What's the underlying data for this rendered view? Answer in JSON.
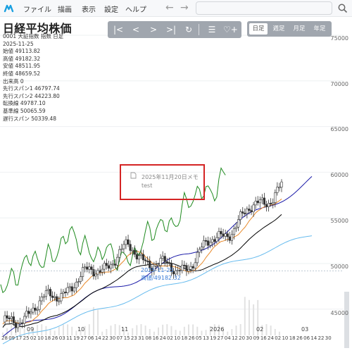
{
  "menubar": {
    "items": [
      "ファイル",
      "描画",
      "表示",
      "設定",
      "ヘルプ"
    ],
    "back_icon": "arrow-left-icon",
    "forward_icon": "arrow-right-icon",
    "search_icon": "search-icon"
  },
  "stock": {
    "title": "日経平均株価",
    "code_line": "0001 大証指数 指数  日足",
    "date": "2025-11-25",
    "open": "始値 49113.82",
    "high": "高値 49182.32",
    "low": "安値 48511.95",
    "close": "終値 48659.52",
    "volume": "出来高 0",
    "span1": "先行スパン1 46797.74",
    "span2": "先行スパン2 44223.80",
    "tenkan": "転換線 49787.10",
    "kijun": "基準線 50065.59",
    "chikou": "遅行スパン 50339.48"
  },
  "toolbar": {
    "buttons": [
      "|<",
      "<",
      ">",
      ">|",
      "↻",
      "☰",
      "♡+"
    ]
  },
  "period": {
    "options": [
      "日足",
      "週足",
      "月足",
      "年足"
    ],
    "active": "日足"
  },
  "memo": {
    "line1": "2025年11月20日メモ",
    "line2": "test"
  },
  "crosshair": {
    "date": "2025-11-25",
    "value": "高値/49182.32"
  },
  "y_axis": [
    "75000",
    "70000",
    "65000",
    "60000",
    "55000",
    "50000",
    "45000"
  ],
  "x_axis": {
    "days": [
      "28",
      "09",
      "17",
      "25",
      "02",
      "10",
      "18",
      "26",
      "03",
      "11",
      "19",
      "27",
      "06",
      "14",
      "22",
      "30",
      "07",
      "15",
      "23",
      "31",
      "08",
      "16",
      "24",
      "02",
      "10",
      "18",
      "26",
      "05",
      "13",
      "19",
      "27",
      "04",
      "12",
      "20",
      "30",
      "09",
      "16",
      "24",
      "02",
      "10",
      "18",
      "26",
      "06",
      "14",
      "22",
      "30"
    ],
    "months": [
      "09",
      "10",
      "11",
      "02",
      "03"
    ],
    "year": "2026"
  },
  "colors": {
    "candle": "#333333",
    "tenkan": "#e88a2b",
    "kijun": "#000000",
    "chikou": "#1e8a1e",
    "span1": "#1a1aa8",
    "span2": "#66bbee",
    "memo_border": "#d42424",
    "accent": "#3a7bd5"
  }
}
